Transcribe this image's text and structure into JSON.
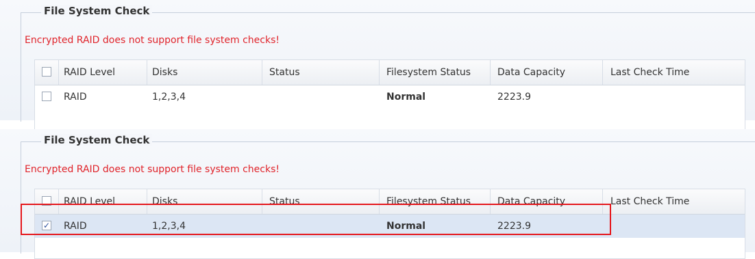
{
  "panels": [
    {
      "legend": "File System Check",
      "warning": "Encrypted RAID does not support file system checks!",
      "columns": [
        "RAID Level",
        "Disks",
        "Status",
        "Filesystem Status",
        "Data Capacity",
        "Last Check Time"
      ],
      "row": {
        "checked": false,
        "raid_level": "RAID",
        "disks": "1,2,3,4",
        "status": "",
        "filesystem_status": "Normal",
        "data_capacity": "2223.9",
        "last_check_time": ""
      }
    },
    {
      "legend": "File System Check",
      "warning": "Encrypted RAID does not support file system checks!",
      "columns": [
        "RAID Level",
        "Disks",
        "Status",
        "Filesystem Status",
        "Data Capacity",
        "Last Check Time"
      ],
      "row": {
        "checked": true,
        "raid_level": "RAID",
        "disks": "1,2,3,4",
        "status": "",
        "filesystem_status": "Normal",
        "data_capacity": "2223.9",
        "last_check_time": ""
      }
    }
  ],
  "icons": {
    "checkmark": "✓",
    "down_arrow": "down-arrow-icon"
  },
  "colors": {
    "warning": "#e0232a",
    "selected_row": "#dce6f4",
    "highlight_border": "#e5151a"
  }
}
